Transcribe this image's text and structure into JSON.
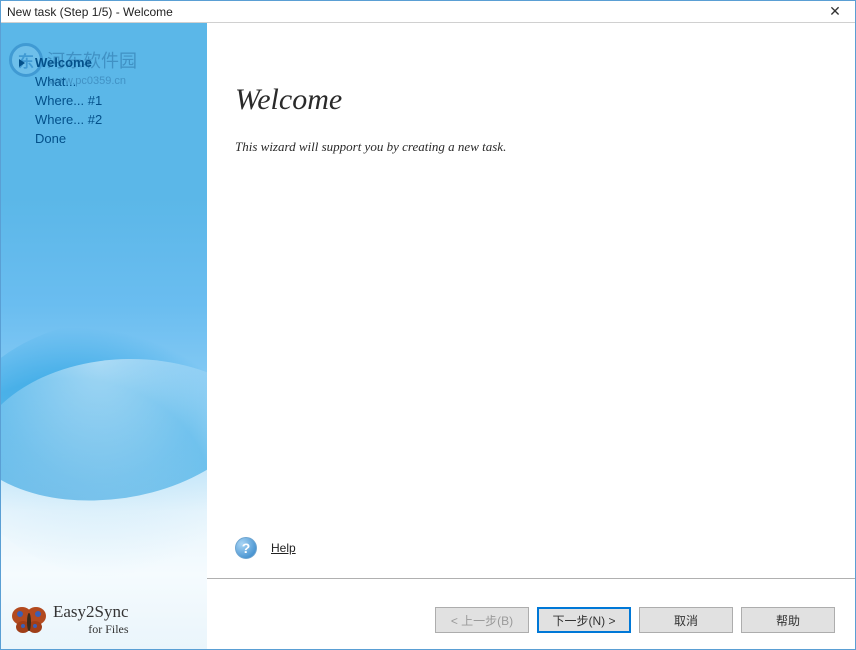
{
  "window": {
    "title": "New task (Step 1/5) - Welcome"
  },
  "watermark": {
    "text": "河东软件园",
    "url": "www.pc0359.cn"
  },
  "sidebar": {
    "items": [
      {
        "label": "Welcome",
        "active": true
      },
      {
        "label": "What...",
        "active": false
      },
      {
        "label": "Where... #1",
        "active": false
      },
      {
        "label": "Where... #2",
        "active": false
      },
      {
        "label": "Done",
        "active": false
      }
    ],
    "brand_line1": "Easy2Sync",
    "brand_line2": "for Files"
  },
  "main": {
    "heading": "Welcome",
    "description": "This wizard will support you by creating a new task.",
    "help_label": "Help"
  },
  "footer": {
    "back": "< 上一步(B)",
    "next": "下一步(N) >",
    "cancel": "取消",
    "help": "帮助"
  }
}
